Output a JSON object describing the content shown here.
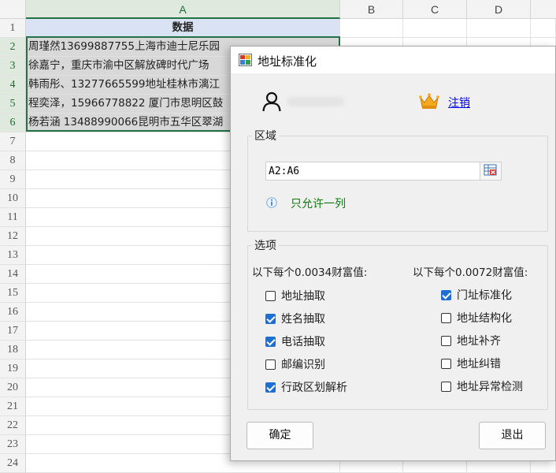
{
  "sheet": {
    "columns": [
      "A",
      "B",
      "C",
      "D"
    ],
    "rows": [
      "1",
      "2",
      "3",
      "4",
      "5",
      "6",
      "7",
      "8",
      "9",
      "10",
      "11",
      "12",
      "13",
      "14",
      "15",
      "16",
      "17",
      "18",
      "19",
      "20",
      "21",
      "22",
      "23",
      "24"
    ],
    "header_cell": "数据",
    "cells": [
      "周瑾然13699887755上海市迪士尼乐园",
      "徐嘉宁，重庆市渝中区解放碑时代广场",
      "韩雨彤、13277665599地址桂林市漓江",
      "程奕泽，15966778822 厦门市思明区鼓",
      "杨若涵 13488990066昆明市五华区翠湖"
    ]
  },
  "dialog": {
    "title": "地址标准化",
    "logout": "注销",
    "region": {
      "label": "区域",
      "range_value": "A2:A6",
      "hint": "只允许一列"
    },
    "options": {
      "label": "选项",
      "left_header": "以下每个0.0034财富值:",
      "right_header": "以下每个0.0072财富值:",
      "left": [
        {
          "label": "地址抽取",
          "checked": false
        },
        {
          "label": "姓名抽取",
          "checked": true
        },
        {
          "label": "电话抽取",
          "checked": true
        },
        {
          "label": "邮编识别",
          "checked": false
        },
        {
          "label": "行政区划解析",
          "checked": true
        }
      ],
      "right": [
        {
          "label": "门址标准化",
          "checked": true
        },
        {
          "label": "地址结构化",
          "checked": false
        },
        {
          "label": "地址补齐",
          "checked": false
        },
        {
          "label": "地址纠错",
          "checked": false
        },
        {
          "label": "地址异常检测",
          "checked": false
        }
      ]
    },
    "ok_button": "确定",
    "exit_button": "退出"
  },
  "colors": {
    "selection_border": "#217346",
    "checkbox_checked": "#1f6fd0",
    "link": "#0000ee",
    "hint": "#117711",
    "header_fill": "#dae3f3"
  }
}
